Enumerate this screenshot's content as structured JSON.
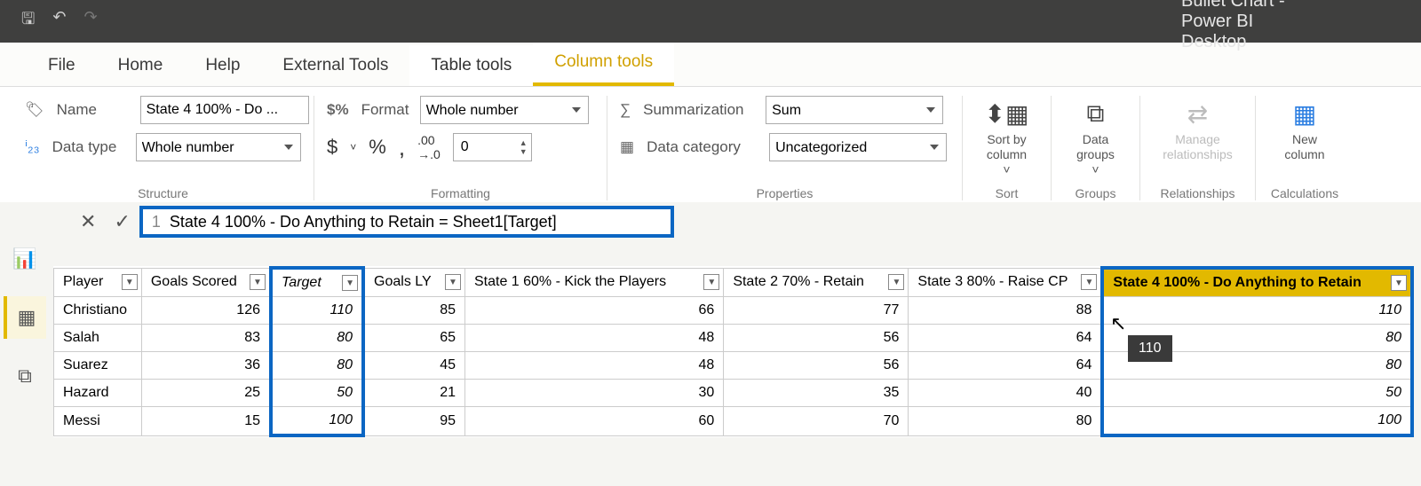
{
  "titlebar": {
    "app_title": "Bullet Chart - Power BI Desktop"
  },
  "menu": {
    "file": "File",
    "home": "Home",
    "help": "Help",
    "external_tools": "External Tools",
    "table_tools": "Table tools",
    "column_tools": "Column tools"
  },
  "ribbon": {
    "structure": {
      "caption": "Structure",
      "name_label": "Name",
      "name_value": "State 4 100% - Do ...",
      "datatype_label": "Data type",
      "datatype_value": "Whole number"
    },
    "formatting": {
      "caption": "Formatting",
      "format_label": "Format",
      "format_value": "Whole number",
      "decimal_value": "0",
      "currency": "$",
      "percent": "%",
      "thousand": ",",
      "decimals_icon": ".00→.0"
    },
    "properties": {
      "caption": "Properties",
      "summarization_label": "Summarization",
      "summarization_value": "Sum",
      "datacategory_label": "Data category",
      "datacategory_value": "Uncategorized"
    },
    "sort": {
      "caption": "Sort",
      "label": "Sort by\ncolumn ˅"
    },
    "groups": {
      "caption": "Groups",
      "label": "Data\ngroups ˅"
    },
    "relationships": {
      "caption": "Relationships",
      "label": "Manage\nrelationships"
    },
    "calculations": {
      "caption": "Calculations",
      "label": "New\ncolumn"
    }
  },
  "formula": {
    "line": "1",
    "text": "State 4 100% - Do Anything to Retain = Sheet1[Target]"
  },
  "table": {
    "headers": [
      "Player",
      "Goals Scored",
      "Target",
      "Goals LY",
      "State 1 60% - Kick the Players",
      "State 2 70% - Retain",
      "State 3 80% - Raise CP",
      "State 4 100% - Do Anything to Retain"
    ],
    "rows": [
      {
        "player": "Christiano",
        "goals": "126",
        "target": "110",
        "ly": "85",
        "s1": "66",
        "s2": "77",
        "s3": "88",
        "s4": "110"
      },
      {
        "player": "Salah",
        "goals": "83",
        "target": "80",
        "ly": "65",
        "s1": "48",
        "s2": "56",
        "s3": "64",
        "s4": "80"
      },
      {
        "player": "Suarez",
        "goals": "36",
        "target": "80",
        "ly": "45",
        "s1": "48",
        "s2": "56",
        "s3": "64",
        "s4": "80"
      },
      {
        "player": "Hazard",
        "goals": "25",
        "target": "50",
        "ly": "21",
        "s1": "30",
        "s2": "35",
        "s3": "40",
        "s4": "50"
      },
      {
        "player": "Messi",
        "goals": "15",
        "target": "100",
        "ly": "95",
        "s1": "60",
        "s2": "70",
        "s3": "80",
        "s4": "100"
      }
    ]
  },
  "tooltip": {
    "value": "110"
  }
}
